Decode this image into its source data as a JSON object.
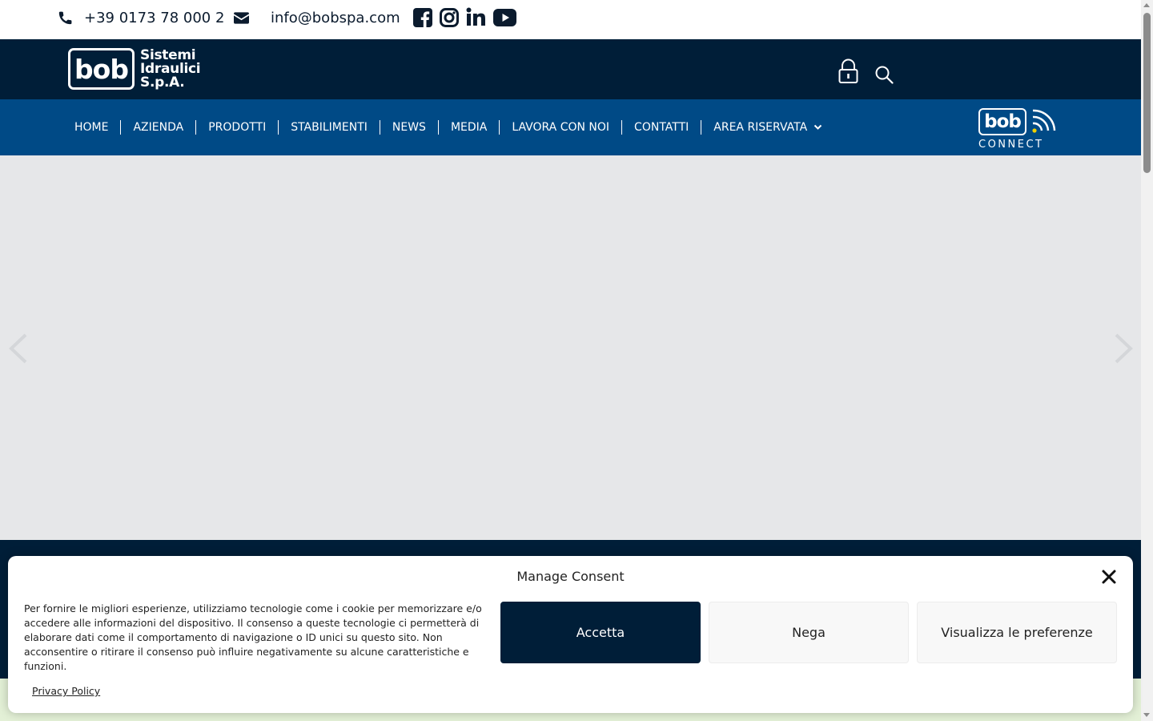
{
  "topbar": {
    "phone": "+39 0173 78 000 2",
    "email": "info@bobspa.com",
    "icons": [
      "phone-icon",
      "envelope-icon",
      "facebook-icon",
      "instagram-icon",
      "linkedin-icon",
      "youtube-icon"
    ]
  },
  "header": {
    "logo_mark": "bob",
    "logo_line1": "Sistemi",
    "logo_line2": "Idraulici",
    "logo_line3": "S.p.A.",
    "icons": [
      "lock-icon",
      "search-icon"
    ]
  },
  "nav": {
    "items": [
      "HOME",
      "AZIENDA",
      "PRODOTTI",
      "STABILIMENTI",
      "NEWS",
      "MEDIA",
      "LAVORA CON NOI",
      "CONTATTI",
      "AREA RISERVATA"
    ],
    "connect_mark": "bob",
    "connect_label": "CONNECT"
  },
  "consent": {
    "title": "Manage Consent",
    "text": "Per fornire le migliori esperienze, utilizziamo tecnologie come i cookie per memorizzare e/o accedere alle informazioni del dispositivo. Il consenso a queste tecnologie ci permetterà di elaborare dati come il comportamento di navigazione o ID unici su questo sito. Non acconsentire o ritirare il consenso può influire negativamente su alcune caratteristiche e funzioni.",
    "accept": "Accetta",
    "deny": "Nega",
    "preferences": "Visualizza le preferenze",
    "privacy": "Privacy Policy"
  },
  "colors": {
    "header_bg": "#001e38",
    "nav_bg": "#004a86",
    "hero_bg": "#e6e7e9",
    "accept_bg": "#001e38",
    "footer_green": "#e3f0d6"
  }
}
